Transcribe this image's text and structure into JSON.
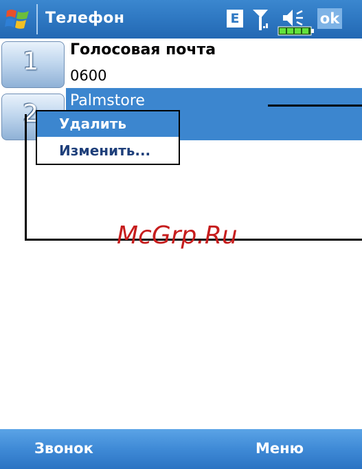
{
  "titlebar": {
    "title": "Телефон",
    "edge_label": "E",
    "ok_label": "ok"
  },
  "speed_dial": [
    {
      "key": "1",
      "name": "Голосовая почта",
      "number": "0600"
    },
    {
      "key": "2",
      "name": "Palmstore"
    }
  ],
  "context_menu": {
    "items": [
      "Удалить",
      "Изменить..."
    ]
  },
  "watermark": "McGrp.Ru",
  "softkeys": {
    "left": "Звонок",
    "right": "Меню"
  },
  "colors": {
    "accent": "#3c86cf",
    "title_bar": "#2f79c3",
    "watermark": "#c61d1d"
  },
  "icons": [
    "windows-start-icon",
    "edge-network-icon",
    "signal-icon",
    "volume-icon",
    "battery-icon"
  ]
}
